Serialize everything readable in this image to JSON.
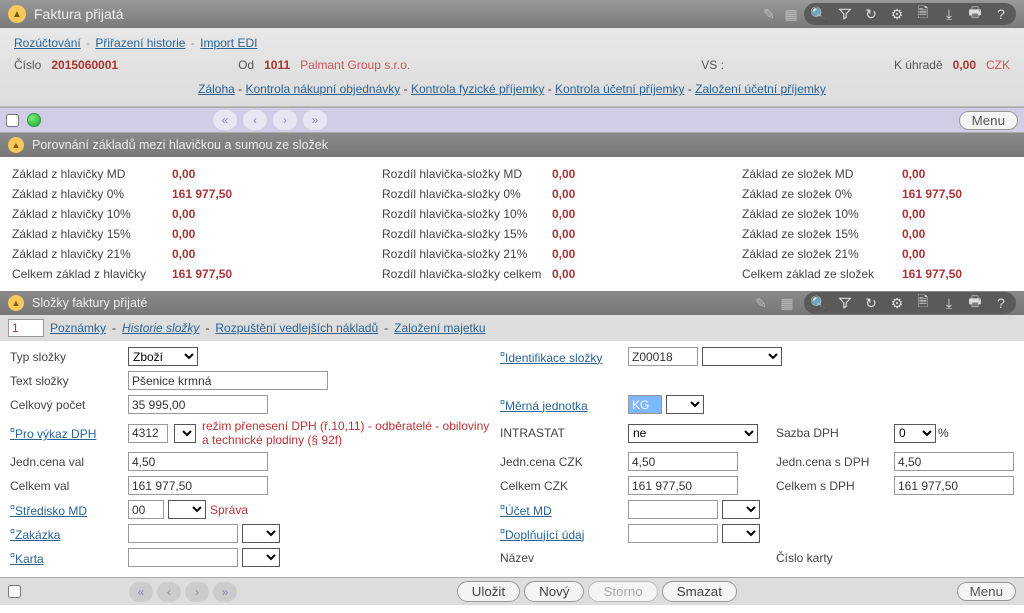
{
  "header": {
    "title": "Faktura přijatá"
  },
  "top_links": {
    "rozuctovani": "Rozúčtování",
    "prirazeni": "Přiřazení historie",
    "import": "Import EDI"
  },
  "info": {
    "cislo_lab": "Číslo",
    "cislo_val": "2015060001",
    "od_lab": "Od",
    "od_code": "1011",
    "od_name": "Palmant Group s.r.o.",
    "vs_lab": "VS :",
    "kuhrade_lab": "K úhradě",
    "kuhrade_val": "0,00",
    "kuhrade_cur": "CZK"
  },
  "center_links": {
    "zaloha": "Záloha",
    "kontrola_nakup": "Kontrola nákupní objednávky",
    "kontrola_fyz": "Kontrola fyzické příjemky",
    "kontrola_ucet": "Kontrola účetní příjemky",
    "zalozeni": "Založení účetní příjemky"
  },
  "nav": {
    "menu": "Menu"
  },
  "comp_section": {
    "title": "Porovnání základů mezi hlavičkou a sumou ze složek",
    "rows": [
      {
        "l1": "Základ z hlavičky MD",
        "v1": "0,00",
        "l2": "Rozdíl hlavička-složky MD",
        "v2": "0,00",
        "l3": "Základ ze složek MD",
        "v3": "0,00"
      },
      {
        "l1": "Základ z hlavičky 0%",
        "v1": "161 977,50",
        "l2": "Rozdíl hlavička-složky 0%",
        "v2": "0,00",
        "l3": "Základ ze složek 0%",
        "v3": "161 977,50"
      },
      {
        "l1": "Základ z hlavičky 10%",
        "v1": "0,00",
        "l2": "Rozdíl hlavička-složky 10%",
        "v2": "0,00",
        "l3": "Základ ze složek 10%",
        "v3": "0,00"
      },
      {
        "l1": "Základ z hlavičky 15%",
        "v1": "0,00",
        "l2": "Rozdíl hlavička-složky 15%",
        "v2": "0,00",
        "l3": "Základ ze složek 15%",
        "v3": "0,00"
      },
      {
        "l1": "Základ z hlavičky 21%",
        "v1": "0,00",
        "l2": "Rozdíl hlavička-složky 21%",
        "v2": "0,00",
        "l3": "Základ ze složek 21%",
        "v3": "0,00"
      },
      {
        "l1": "Celkem základ z hlavičky",
        "v1": "161 977,50",
        "l2": "Rozdíl hlavička-složky celkem",
        "v2": "0,00",
        "l3": "Celkem základ ze složek",
        "v3": "161 977,50"
      }
    ]
  },
  "items_section": {
    "title": "Složky faktury přijaté",
    "index": "1",
    "links": {
      "poznamky": "Poznámky",
      "historie": "Historie složky",
      "rozpusteni": "Rozpuštění vedlejších nákladů",
      "zalozeni_maj": "Založení majetku"
    }
  },
  "form": {
    "typ_lab": "Typ složky",
    "typ_val": "Zboží",
    "ident_lab": "Identifikace složky",
    "ident_val": "Z00018",
    "text_lab": "Text složky",
    "text_val": "Pšenice krmná",
    "pocet_lab": "Celkový počet",
    "pocet_val": "35 995,00",
    "mj_lab": "Měrná jednotka",
    "mj_val": "KG",
    "dph_lab": "Pro výkaz DPH",
    "dph_val": "4312",
    "dph_note": "režim přenesení DPH (ř.10,11) - odběratelé - obiloviny a technické plodiny (§ 92f)",
    "intrastat_lab": "INTRASTAT",
    "intrastat_val": "ne",
    "sazba_lab": "Sazba DPH",
    "sazba_val": "0",
    "sazba_suffix": "%",
    "jcval_lab": "Jedn.cena val",
    "jcval_val": "4,50",
    "jcczk_lab": "Jedn.cena CZK",
    "jcczk_val": "4,50",
    "jcdph_lab": "Jedn.cena s DPH",
    "jcdph_val": "4,50",
    "cval_lab": "Celkem val",
    "cval_val": "161 977,50",
    "cczk_lab": "Celkem CZK",
    "cczk_val": "161 977,50",
    "cdph_lab": "Celkem s DPH",
    "cdph_val": "161 977,50",
    "stred_lab": "Středisko MD",
    "stred_val": "00",
    "stred_name": "Správa",
    "ucet_lab": "Účet MD",
    "zakazka_lab": "Zakázka",
    "dopl_lab": "Doplňující údaj",
    "karta_lab": "Karta",
    "nazev_lab": "Název",
    "cislokarty_lab": "Číslo karty"
  },
  "buttons": {
    "ulozit": "Uložit",
    "novy": "Nový",
    "storno": "Storno",
    "smazat": "Smazat",
    "menu": "Menu"
  }
}
